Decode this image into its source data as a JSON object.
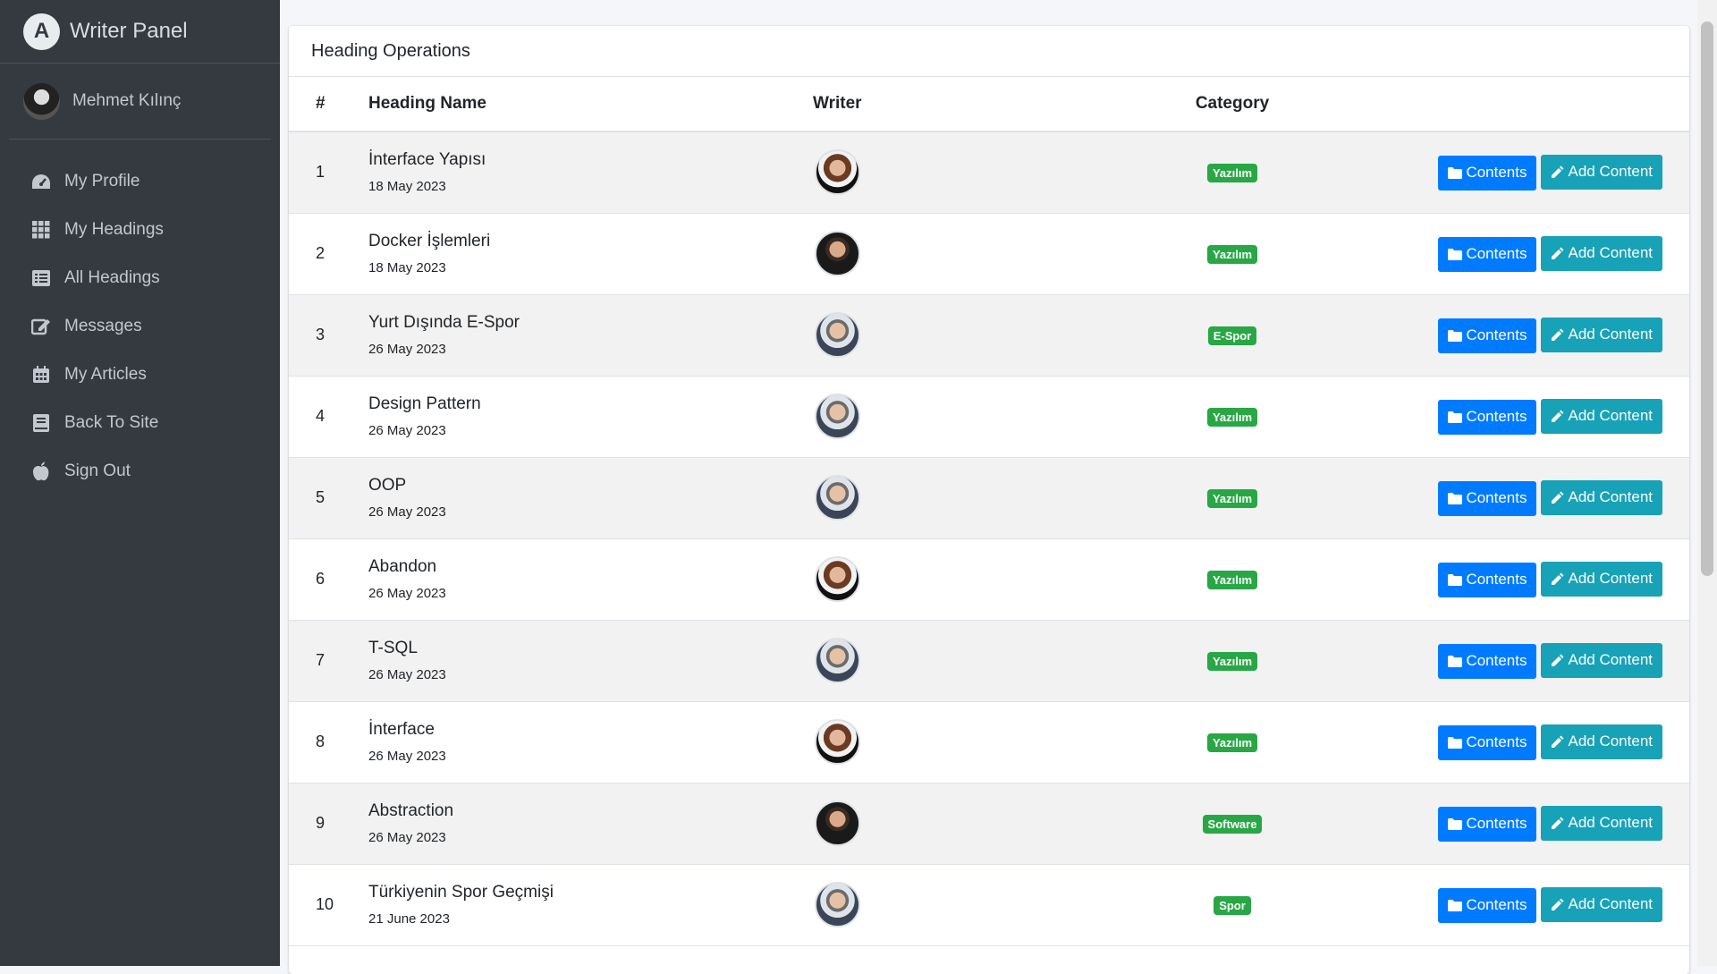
{
  "brand": {
    "title": "Writer Panel"
  },
  "user": {
    "name": "Mehmet Kılınç"
  },
  "nav": [
    {
      "label": "My Profile",
      "icon": "dashboard-icon"
    },
    {
      "label": "My Headings",
      "icon": "grid-icon"
    },
    {
      "label": "All Headings",
      "icon": "list-icon"
    },
    {
      "label": "Messages",
      "icon": "edit-icon"
    },
    {
      "label": "My Articles",
      "icon": "calendar-icon"
    },
    {
      "label": "Back To Site",
      "icon": "book-icon"
    },
    {
      "label": "Sign Out",
      "icon": "apple-icon"
    }
  ],
  "card": {
    "title": "Heading Operations"
  },
  "table": {
    "headers": {
      "num": "#",
      "name": "Heading Name",
      "writer": "Writer",
      "category": "Category"
    },
    "buttons": {
      "contents": "Contents",
      "add": "Add Content"
    },
    "colors": {
      "contents": "#007bff",
      "add": "#17a2b8",
      "badge": "#28a745"
    },
    "rows": [
      {
        "num": "1",
        "name": "İnterface Yapısı",
        "date": "18 May 2023",
        "category": "Yazılım",
        "writer_avatar": "female-writer"
      },
      {
        "num": "2",
        "name": "Docker İşlemleri",
        "date": "18 May 2023",
        "category": "Yazılım",
        "writer_avatar": "male-writer-dark"
      },
      {
        "num": "3",
        "name": "Yurt Dışında E-Spor",
        "date": "26 May 2023",
        "category": "E-Spor",
        "writer_avatar": "male-writer-glasses"
      },
      {
        "num": "4",
        "name": "Design Pattern",
        "date": "26 May 2023",
        "category": "Yazılım",
        "writer_avatar": "male-writer-glasses"
      },
      {
        "num": "5",
        "name": "OOP",
        "date": "26 May 2023",
        "category": "Yazılım",
        "writer_avatar": "male-writer-glasses"
      },
      {
        "num": "6",
        "name": "Abandon",
        "date": "26 May 2023",
        "category": "Yazılım",
        "writer_avatar": "female-writer"
      },
      {
        "num": "7",
        "name": "T-SQL",
        "date": "26 May 2023",
        "category": "Yazılım",
        "writer_avatar": "male-writer-glasses"
      },
      {
        "num": "8",
        "name": "İnterface",
        "date": "26 May 2023",
        "category": "Yazılım",
        "writer_avatar": "female-writer"
      },
      {
        "num": "9",
        "name": "Abstraction",
        "date": "26 May 2023",
        "category": "Software",
        "writer_avatar": "male-writer-dark"
      },
      {
        "num": "10",
        "name": "Türkiyenin Spor Geçmişi",
        "date": "21 June 2023",
        "category": "Spor",
        "writer_avatar": "male-writer-glasses"
      }
    ]
  }
}
